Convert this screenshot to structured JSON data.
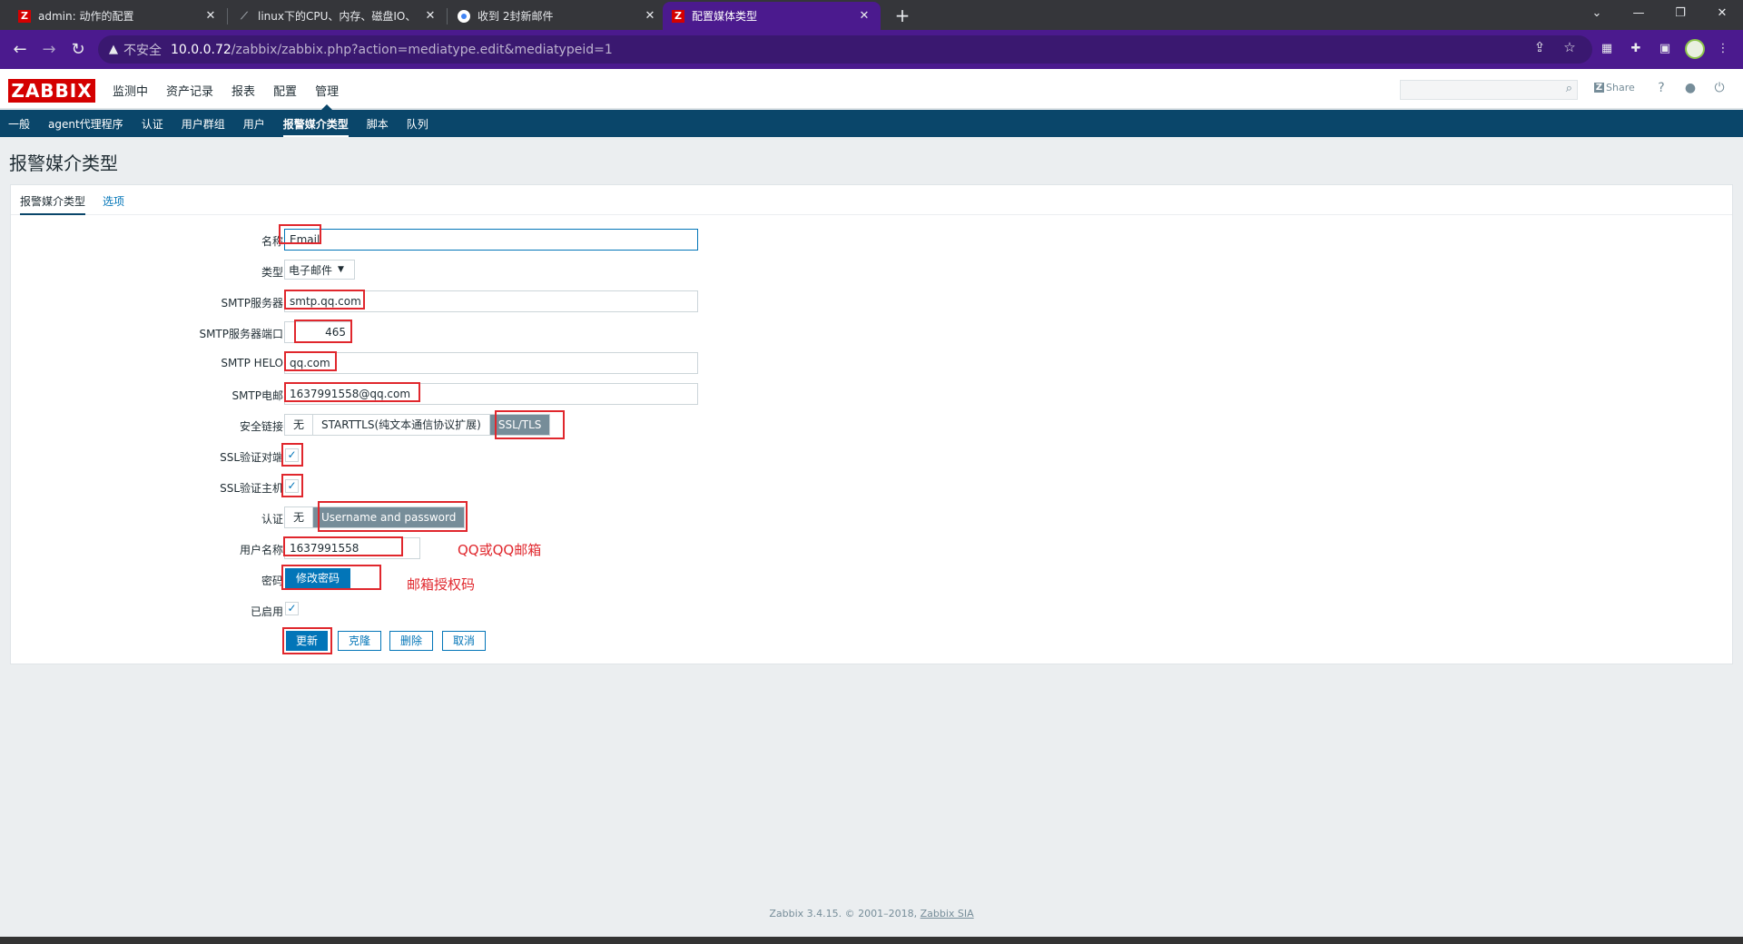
{
  "browser": {
    "tabs": [
      {
        "title": "admin: 动作的配置",
        "icon": "zabbix-icon"
      },
      {
        "title": "linux下的CPU、内存、磁盘IO、",
        "icon": "document-icon"
      },
      {
        "title": "收到 2封新邮件",
        "icon": "mail-icon"
      },
      {
        "title": "配置媒体类型",
        "icon": "zabbix-icon",
        "active": true
      }
    ],
    "new_tab": "+",
    "tab_close": "✕",
    "insecure_label": "不安全",
    "url_host": "10.0.0.72",
    "url_path": "/zabbix/zabbix.php?action=mediatype.edit&mediatypeid=1",
    "window_controls": [
      "⌄",
      "—",
      "❐",
      "✕"
    ]
  },
  "header": {
    "logo": "ZABBIX",
    "menu": [
      "监测中",
      "资产记录",
      "报表",
      "配置",
      "管理"
    ],
    "selected_menu": "管理",
    "share_label": "Share",
    "share_badge": "Z",
    "help": "?"
  },
  "sub_nav": [
    "一般",
    "agent代理程序",
    "认证",
    "用户群组",
    "用户",
    "报警媒介类型",
    "脚本",
    "队列"
  ],
  "page_title": "报警媒介类型",
  "form": {
    "tabs": [
      "报警媒介类型",
      "选项"
    ],
    "labels": {
      "name": "名称",
      "type": "类型",
      "smtp_server": "SMTP服务器",
      "smtp_port": "SMTP服务器端口",
      "smtp_helo": "SMTP HELO",
      "smtp_email": "SMTP电邮",
      "security": "安全链接",
      "ssl_verify_peer": "SSL验证对端",
      "ssl_verify_host": "SSL验证主机",
      "auth": "认证",
      "username": "用户名称",
      "password": "密码",
      "enabled": "已启用"
    },
    "values": {
      "name": "Email",
      "type": "电子邮件",
      "smtp_server": "smtp.qq.com",
      "smtp_port": "465",
      "smtp_helo": "qq.com",
      "smtp_email": "1637991558@qq.com",
      "username": "1637991558"
    },
    "security_options": [
      "无",
      "STARTTLS(纯文本通信协议扩展)",
      "SSL/TLS"
    ],
    "security_selected": "SSL/TLS",
    "auth_options": [
      "无",
      "Username and password"
    ],
    "auth_selected": "Username and password",
    "change_password": "修改密码",
    "check": "✓",
    "buttons": {
      "update": "更新",
      "clone": "克隆",
      "delete": "删除",
      "cancel": "取消"
    }
  },
  "annotations": {
    "username_note": "QQ或QQ邮箱",
    "password_note": "邮箱授权码",
    "color": "#e0272d"
  },
  "footer": {
    "text": "Zabbix 3.4.15. © 2001–2018, ",
    "link": "Zabbix SIA"
  }
}
